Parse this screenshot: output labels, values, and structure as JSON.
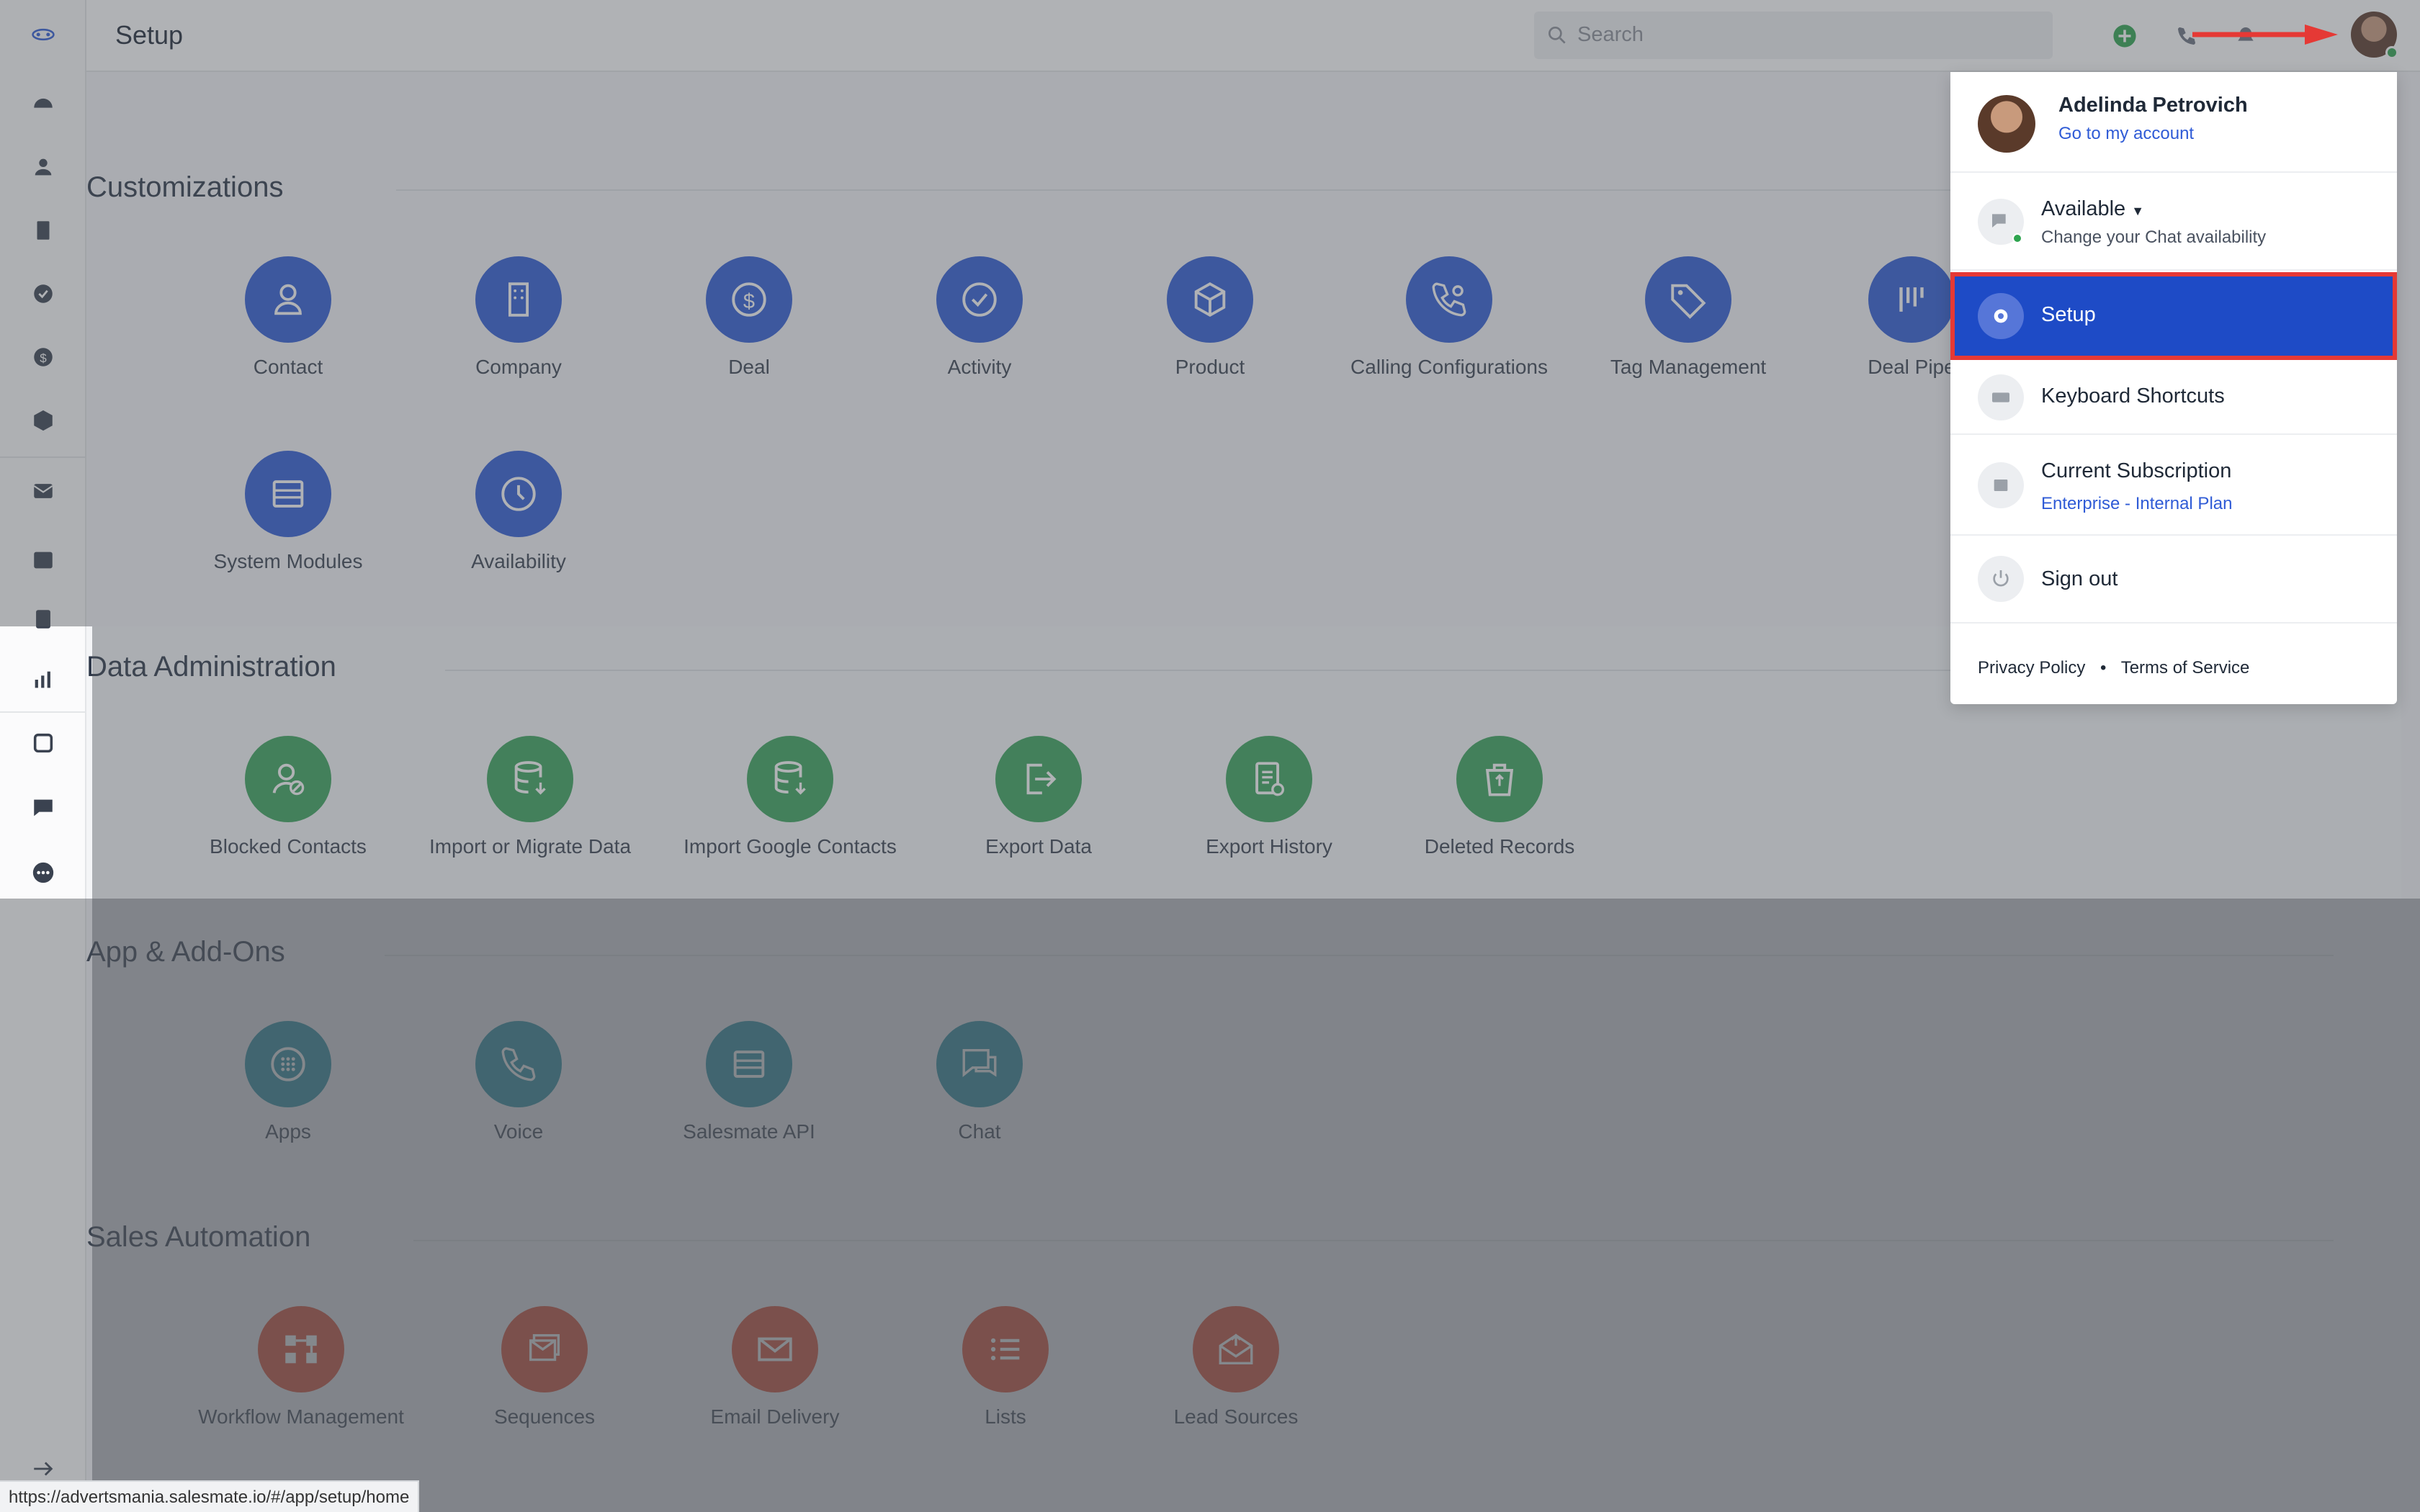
{
  "app": {
    "page_title": "Setup"
  },
  "header": {
    "search_placeholder": "Search"
  },
  "sections": {
    "customizations": {
      "title": "Customizations",
      "items": [
        "Contact",
        "Company",
        "Deal",
        "Activity",
        "Product",
        "Calling Configurations",
        "Tag Management",
        "Deal Pipe",
        "System Modules",
        "Availability"
      ]
    },
    "data_admin": {
      "title": "Data Administration",
      "items": [
        "Blocked Contacts",
        "Import or Migrate Data",
        "Import Google Contacts",
        "Export Data",
        "Export History",
        "Deleted Records"
      ]
    },
    "addons": {
      "title": "App & Add-Ons",
      "items": [
        "Apps",
        "Voice",
        "Salesmate API",
        "Chat"
      ]
    },
    "automation": {
      "title": "Sales Automation",
      "items": [
        "Workflow Management",
        "Sequences",
        "Email Delivery",
        "Lists",
        "Lead Sources"
      ]
    }
  },
  "menu": {
    "user_name": "Adelinda Petrovich",
    "account_link": "Go to my account",
    "availability": "Available",
    "availability_sub": "Change your Chat availability",
    "setup": "Setup",
    "shortcuts": "Keyboard Shortcuts",
    "subscription": "Current Subscription",
    "plan": "Enterprise - Internal Plan",
    "sign_out": "Sign out",
    "privacy": "Privacy Policy",
    "separator": "•",
    "terms": "Terms of Service"
  },
  "status_url": "https://advertsmania.salesmate.io/#/app/setup/home",
  "colors": {
    "blue": "#2f5bd6",
    "green": "#3aa55b",
    "teal": "#1f8fa2",
    "red": "#df4a2c",
    "highlight": "#1e4bc6",
    "annotation": "#e53935"
  }
}
